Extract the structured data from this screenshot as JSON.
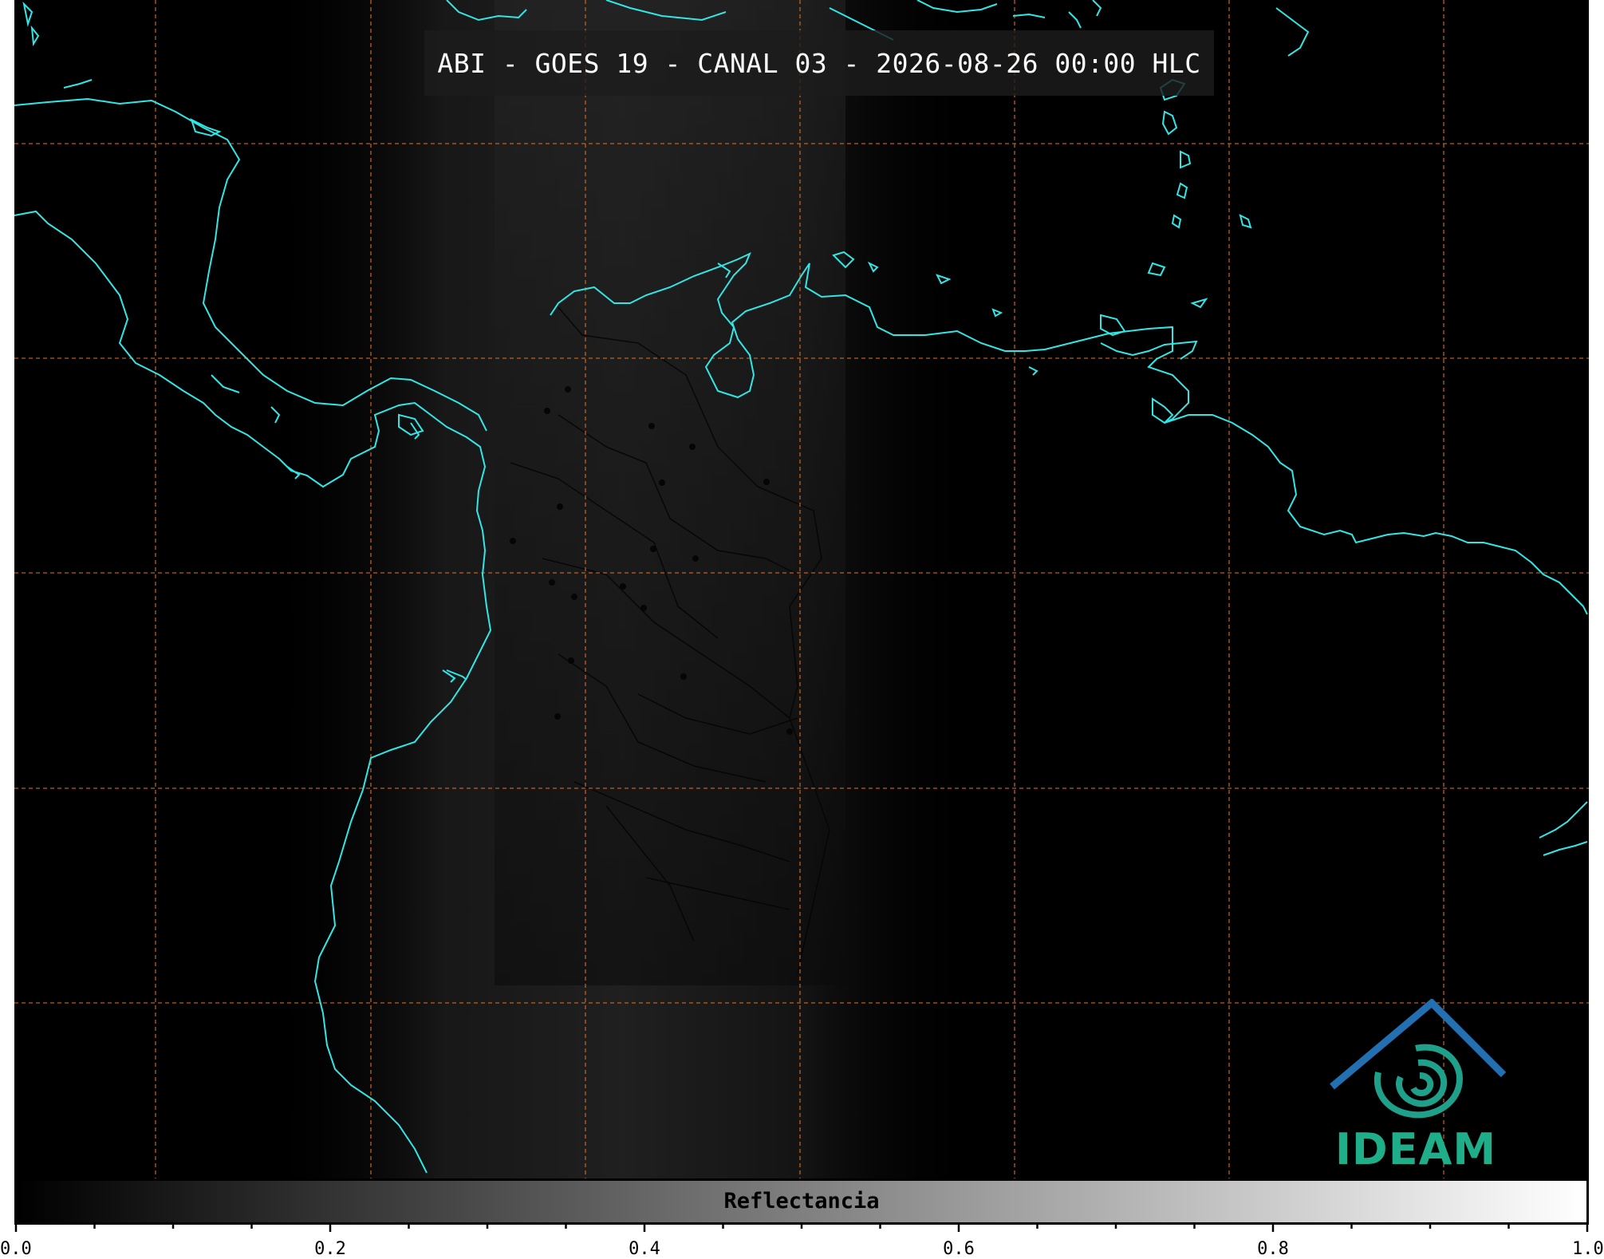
{
  "title": "ABI - GOES 19 - CANAL 03 - 2026-08-26 00:00 HLC",
  "colorbar": {
    "label": "Reflectancia",
    "min": 0.0,
    "max": 1.0,
    "ticks": [
      "0.0",
      "0.2",
      "0.4",
      "0.6",
      "0.8",
      "1.0"
    ],
    "minor_ticks_per_major": 4,
    "colormap": "greys"
  },
  "map": {
    "background_color": "#000000",
    "coastline_color": "#33e6e6",
    "gridline_color": "#d2691e",
    "gridline_style": "dashed",
    "vertical_gridlines": 7,
    "horizontal_gridlines": 5
  },
  "logo": {
    "text": "IDEAM",
    "colors": [
      "#2468b4",
      "#1fae8a"
    ]
  }
}
